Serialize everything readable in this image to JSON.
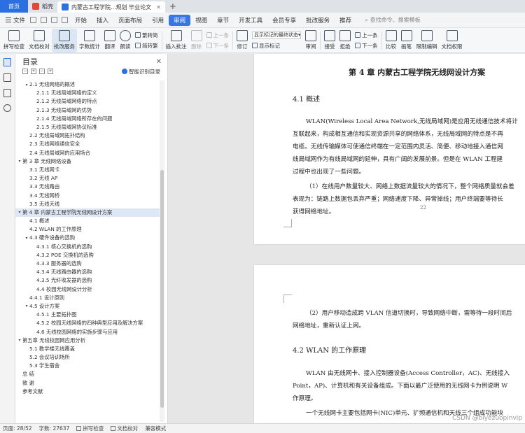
{
  "titlebar": {
    "home": "首页",
    "tabs": [
      {
        "label": "稻壳",
        "active": false
      },
      {
        "label": "内蒙古工程学院...规划 毕业论文",
        "active": true
      }
    ]
  },
  "menubar": {
    "file": "文件",
    "items": [
      "开始",
      "插入",
      "页面布局",
      "引用",
      "审阅",
      "视图",
      "章节",
      "开发工具",
      "会员专享",
      "批改服务",
      "推荐"
    ],
    "active": "审阅",
    "search": "查找命令、搜索模板"
  },
  "ribbon": {
    "spell_check": "拼写检查",
    "doc_proof": "文档校对",
    "correction": "批改服务",
    "word_count": "字数统计",
    "translate": "翻译",
    "read_aloud": "朗读",
    "trad_simp": "繁转简",
    "simp_trad": "简转繁",
    "insert_comment": "插入批注",
    "delete": "删除",
    "prev_comment": "上一条",
    "next_comment": "下一条",
    "track_changes": "修订",
    "show_markup": "显示标记的最终状态",
    "show_marks": "显示标记",
    "reviewer": "审阅",
    "accept": "接受",
    "reject": "拒绝",
    "prev_change": "上一条",
    "next_change": "下一条",
    "compare": "比较",
    "ink": "画笔",
    "restrict_edit": "限制编辑",
    "doc_permission": "文档权限"
  },
  "toc": {
    "title": "目录",
    "smart_label": "智能识别目录",
    "items": [
      {
        "text": "2.1 无线网络的概述",
        "level": 2,
        "expand": "▾"
      },
      {
        "text": "2.1.1 无线局域网络的定义",
        "level": 3
      },
      {
        "text": "2.1.2 无线局域网络的特点",
        "level": 3
      },
      {
        "text": "2.1.3 无线局域网的优势",
        "level": 3
      },
      {
        "text": "2.1.4 无线局域网络所存在的问题",
        "level": 3
      },
      {
        "text": "2.1.5 无线局域网协议标准",
        "level": 3
      },
      {
        "text": "2.2 无线局域网拓扑结构",
        "level": 2
      },
      {
        "text": "2.3 无线网络通信安全",
        "level": 2
      },
      {
        "text": "2.4 无线局域网的应用场合",
        "level": 2
      },
      {
        "text": "第 3 章 无线网络设备",
        "level": 1,
        "expand": "▾"
      },
      {
        "text": "3.1 无线网卡",
        "level": 2
      },
      {
        "text": "3.2 无线 AP",
        "level": 2
      },
      {
        "text": "3.3 无线路由",
        "level": 2
      },
      {
        "text": "3.4 无线网桥",
        "level": 2
      },
      {
        "text": "3.5 无线天线",
        "level": 2
      },
      {
        "text": "第 4 章 内蒙古工程学院无线网设计方案",
        "level": 1,
        "expand": "▾",
        "selected": true
      },
      {
        "text": "4.1 概述",
        "level": 2
      },
      {
        "text": "4.2 WLAN 的工作原理",
        "level": 2
      },
      {
        "text": "4.3 硬件设备的选购",
        "level": 2,
        "expand": "▾"
      },
      {
        "text": "4.3.1 核心交换机的选购",
        "level": 3
      },
      {
        "text": "4.3.2 POE 交换机的选购",
        "level": 3
      },
      {
        "text": "4.3.3 服务器的选购",
        "level": 3
      },
      {
        "text": "4.3.4 无线路由器的选购",
        "level": 3
      },
      {
        "text": "4.3.5 光纤收发器的选购",
        "level": 3
      },
      {
        "text": "4.4 校园无线网设计分析",
        "level": 3
      },
      {
        "text": "4.4.1 设计原则",
        "level": 2
      },
      {
        "text": "4.5 设计方案",
        "level": 2,
        "expand": "▾"
      },
      {
        "text": "4.5.1 主要拓扑图",
        "level": 3
      },
      {
        "text": "4.5.2 校园无线网络的四种典型应用及解决方案",
        "level": 3
      },
      {
        "text": "4.6 无线校园网络的实施步骤与应用",
        "level": 3
      },
      {
        "text": "第五章 无线校园网应用分析",
        "level": 1,
        "expand": "▾"
      },
      {
        "text": "5.1 教学楼无线覆盖",
        "level": 2
      },
      {
        "text": "5.2 会议培训场所",
        "level": 2
      },
      {
        "text": "5.3 学生宿舍",
        "level": 2
      },
      {
        "text": "总  结",
        "level": 1
      },
      {
        "text": "致  谢",
        "level": 1
      },
      {
        "text": "参考文献",
        "level": 1
      }
    ]
  },
  "document": {
    "chapter_title": "第 4 章  内蒙古工程学院无线网设计方案",
    "section_41": "4.1 概述",
    "p1_lines": [
      "WLAN(Wireless Local Area Network,无线局域网)是应用无线通信技术将计",
      "互联起来，构成相互通信和实现资源共享的网络体系，无线局域网的特点是不再",
      "电缆。无线传输媒体可使通信终端在一定范围内灵活、简便、移动地接入通信网",
      "线局域网作为有线局域网的延伸，具有广阔的发展前景。但是在 WLAN 工程建",
      "过程中也出现了一些问题。"
    ],
    "p2_lines": [
      "（1）在线用户数量较大、网络上数据流量较大的情况下，整个网络质量就会差",
      "表现为：链路上数据包丢弃严重；网络速度下降、异常掉线；用户终端要等待长",
      "获得网络地址。"
    ],
    "page_number": "22",
    "p3_lines": [
      "（2）用户移动造成跨 VLAN 信道切换时，导致网络中断，需等待一段时间后",
      "网络地址，重新认证上网。"
    ],
    "section_42": "4.2 WLAN 的工作原理",
    "p4_lines": [
      "WLAN 由无线网卡、接入控制器设备(Access Controller，AC)、无线接入",
      "Point，AP)、计算机和有关设备组成。下面以最广泛使用的无线网卡为例说明 W",
      "作原理。"
    ],
    "p5_line": "一个无线网卡主要包括网卡(NIC)单元、扩频通信机和天线三个组成功能块",
    "watermark": "CSDN @biyezuopinvip"
  },
  "statusbar": {
    "page": "页面: 28/52",
    "words": "字数: 27637",
    "spell": "拼写检查",
    "proof": "文档校对",
    "compat": "兼容模式"
  }
}
